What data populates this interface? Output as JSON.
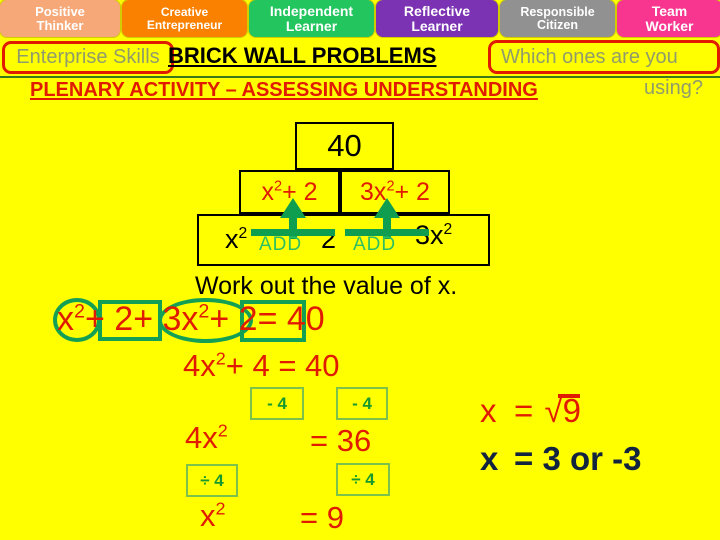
{
  "tabs": [
    {
      "line1": "Positive",
      "line2": "Thinker",
      "color": "#F7A878"
    },
    {
      "line1": "Creative",
      "line2": "Entrepreneur",
      "color": "#FA8000"
    },
    {
      "line1": "Independent",
      "line2": "Learner",
      "color": "#22C55E"
    },
    {
      "line1": "Reflective",
      "line2": "Learner",
      "color": "#7B32B3"
    },
    {
      "line1": "Responsible",
      "line2": "Citizen",
      "color": "#919191"
    },
    {
      "line1": "Team",
      "line2": "Worker",
      "color": "#F8368F"
    }
  ],
  "header": {
    "enterprise_skills": "Enterprise Skills",
    "brick_wall": "BRICK WALL PROBLEMS",
    "which_ones": "Which ones are you",
    "using": "using?",
    "plenary": "PLENARY ACTIVITY – ASSESSING UNDERSTANDING"
  },
  "pyramid": {
    "top": "40",
    "mid_left_base": "x",
    "mid_left_exp": "2",
    "mid_left_rest": "+ 2",
    "mid_right_pre": "3x",
    "mid_right_exp": "2",
    "mid_right_rest": "+ 2",
    "bottom_1_base": "x",
    "bottom_1_exp": "2",
    "bottom_2": "2",
    "bottom_3_base": "3x",
    "bottom_3_exp": "2",
    "add_label_1": "ADD",
    "add_label_2": "ADD"
  },
  "instruction": "Work out the value of x.",
  "working": {
    "eq1_a_base": "x",
    "eq1_a_exp": "2",
    "eq1_b": "+ 2",
    "eq1_c_pre": "+ 3x",
    "eq1_c_exp": "2",
    "eq1_d": "+ 2",
    "eq1_e": "= 40",
    "eq2_pre": "4x",
    "eq2_exp": "2",
    "eq2_rest": "+ 4 = 40",
    "op_minus4_left": "- 4",
    "op_minus4_right": "- 4",
    "eq3_left_pre": "4x",
    "eq3_left_exp": "2",
    "eq3_right": "= 36",
    "op_div4_left": "÷ 4",
    "op_div4_right": "÷ 4",
    "eq4_left_pre": "x",
    "eq4_left_exp": "2",
    "eq4_right": "= 9"
  },
  "answers": {
    "ans1_var": "x",
    "ans1_eq": "=",
    "ans1_radical": "√",
    "ans1_value": "9",
    "ans2_var": "x",
    "ans2_rest": "= 3 or -3"
  },
  "colors": {
    "background": "#FFFF00",
    "red": "#E01B00",
    "green": "#13A055",
    "navy": "#12233F",
    "gray_green_text": "#909C6A"
  }
}
